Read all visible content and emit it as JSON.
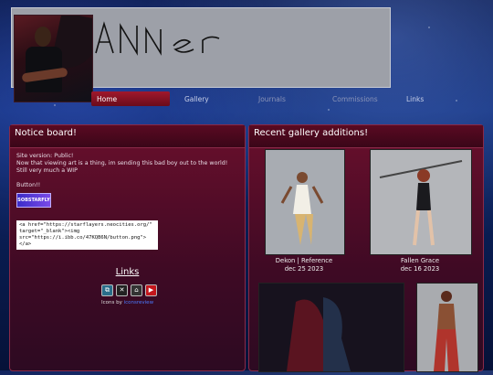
{
  "site": {
    "signature_text": "ANNer"
  },
  "nav": {
    "items": [
      {
        "label": "Home"
      },
      {
        "label": "Gallery"
      },
      {
        "label": "Journals"
      },
      {
        "label": "Commissions"
      },
      {
        "label": "Links"
      }
    ]
  },
  "notice": {
    "title": "Notice board!",
    "lines": [
      "Site version: Public!",
      "Now that viewing art is a thing, im sending this bad boy out to the world!",
      "Still very much a WIP"
    ],
    "button_label": "Button!!",
    "badge_text": "SOBSTARFLY",
    "code": "<a href=\"https://starflayers.neocities.org/\" target=\"_blank\"><img src=\"https://i.ibb.co/47KQB6N/button.png\"></a>",
    "links_title": "Links",
    "icons_credit_prefix": "Icons by",
    "icons_credit_link": "iconsreview",
    "icons": [
      "neocities-icon",
      "twitter-icon",
      "home-icon",
      "youtube-icon"
    ]
  },
  "gallery": {
    "title": "Recent gallery additions!",
    "items": [
      {
        "title": "Dekon | Reference",
        "date": "dec 25 2023"
      },
      {
        "title": "Fallen Grace",
        "date": "dec 16 2023"
      }
    ]
  }
}
